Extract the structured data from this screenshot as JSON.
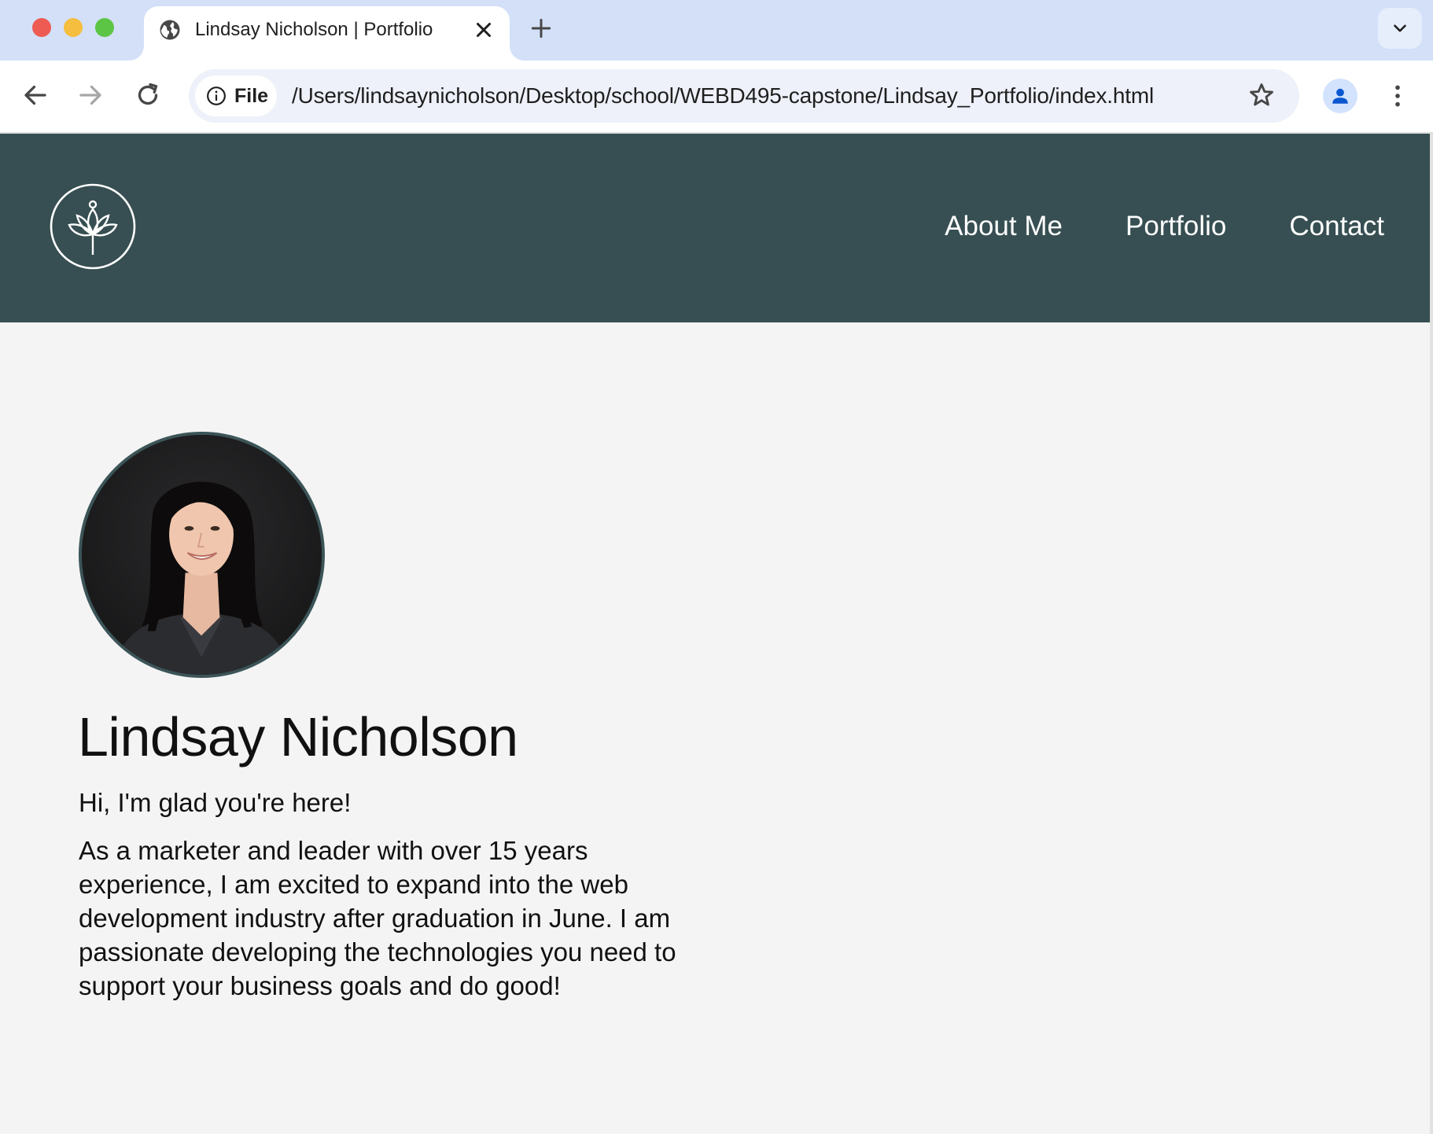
{
  "browser": {
    "tab_title": "Lindsay Nicholson | Portfolio",
    "site_chip_label": "File",
    "url": "/Users/lindsaynicholson/Desktop/school/WEBD495-capstone/Lindsay_Portfolio/index.html",
    "icons": [
      "globe-icon",
      "close-icon",
      "plus-icon",
      "chevron-down-icon",
      "back-arrow-icon",
      "forward-arrow-icon",
      "reload-icon",
      "info-icon",
      "star-icon",
      "profile-icon",
      "kebab-menu-icon"
    ]
  },
  "header": {
    "logo_icon": "lotus-logo-icon",
    "nav": [
      {
        "label": "About Me"
      },
      {
        "label": "Portfolio"
      },
      {
        "label": "Contact"
      }
    ]
  },
  "hero": {
    "name": "Lindsay Nicholson",
    "greeting": "Hi, I'm glad you're here!",
    "bio": "As a marketer and leader with over 15 years experience, I am excited to expand into the web development industry after graduation in June. I am passionate developing the technologies you need to support your business goals and do good!"
  },
  "colors": {
    "header_bg": "#374f52",
    "page_bg": "#f4f4f4",
    "tabstrip_bg": "#d3e0f8",
    "avatar_border": "#3b5457"
  }
}
